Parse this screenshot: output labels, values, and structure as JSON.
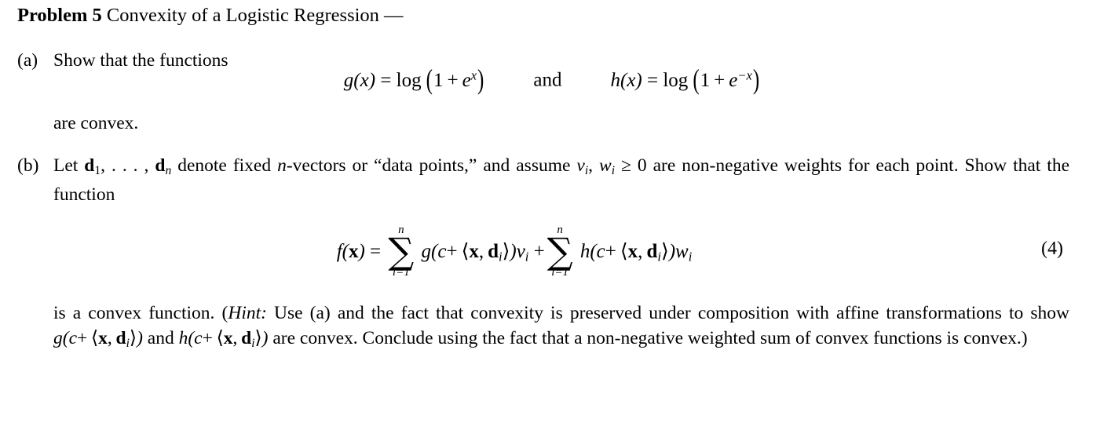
{
  "document": {
    "problem": {
      "label": "Problem 5",
      "title": "Convexity of a Logistic Regression —"
    },
    "items": [
      {
        "marker": "(a)",
        "lead_text": "Show that the functions",
        "equation": {
          "left": "g(x) = log (1 + e^x)",
          "conjunction": "and",
          "right": "h(x) = log (1 + e^{-x})",
          "parts": {
            "g_name": "g",
            "h_name": "h",
            "arg": "x",
            "log": "log",
            "one": "1",
            "plus": "+",
            "e": "e",
            "exp_pos": "x",
            "exp_neg": "−x",
            "equals": "="
          }
        },
        "trailing_text": "are convex."
      },
      {
        "marker": "(b)",
        "paragraph_1": {
          "t1": "Let ",
          "d": "d",
          "sub1": "1",
          "comma_dots": ", . . . , ",
          "subn": "n",
          "t2": " denote fixed ",
          "n": "n",
          "t3": "-vectors or “data points,” and assume ",
          "v": "v",
          "subi1": "i",
          "t4": ", ",
          "w": "w",
          "subi2": "i",
          "t5": " ≥ 0 are non-negative weights for each point. Show that the function"
        },
        "equation_4": {
          "number": "(4)",
          "f": "f",
          "xbold": "x",
          "equals": "=",
          "sigma": "∑",
          "limit_top": "n",
          "limit_bottom": "i=1",
          "g": "g",
          "h": "h",
          "c": "c",
          "plus": "+",
          "angle_open": "⟨",
          "angle_close": "⟩",
          "dbold": "d",
          "sub_i": "i",
          "v": "v",
          "w": "w"
        },
        "paragraph_2": {
          "t1": "is a convex function. (",
          "hint": "Hint:",
          "t2": " Use (a) and the fact that convexity is preserved under composition with affine transformations to show ",
          "expr_g": "g(c+⟨x, d_i⟩)",
          "t3": " and ",
          "expr_h": "h(c+⟨x, d_i⟩)",
          "t4": " are convex. Conclude using the fact that a non-negative weighted sum of convex functions is convex.)"
        }
      }
    ]
  }
}
